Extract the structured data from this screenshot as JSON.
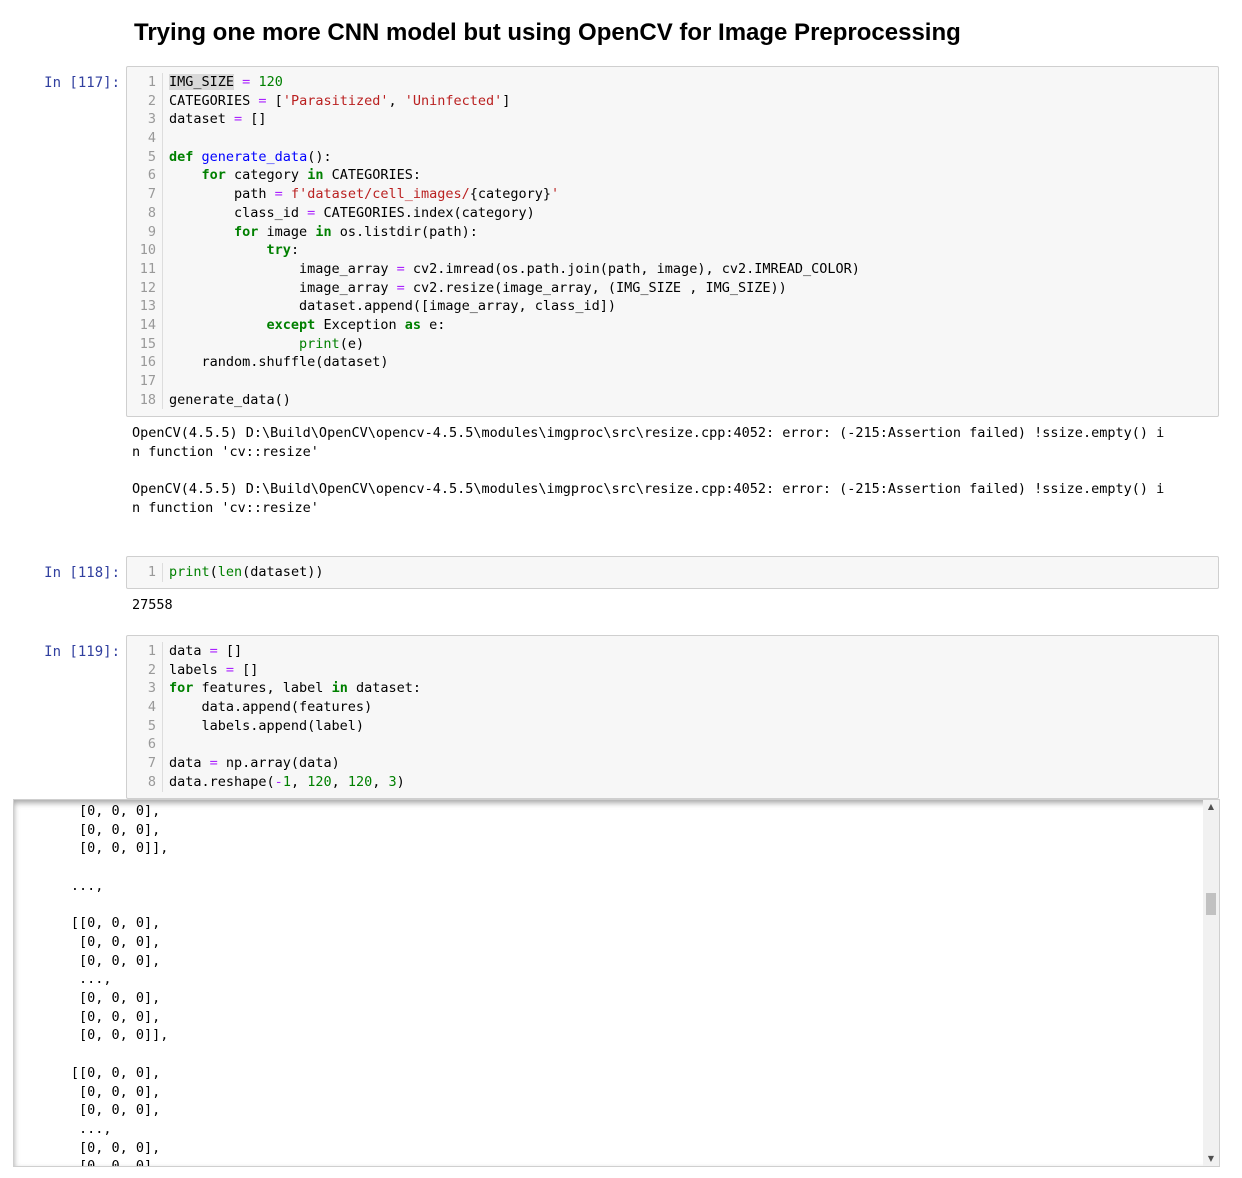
{
  "heading": "Trying one more CNN model but using OpenCV for Image Preprocessing",
  "cells": [
    {
      "prompt": "In [117]:",
      "line_numbers": [
        "1",
        "2",
        "3",
        "4",
        "5",
        "6",
        "7",
        "8",
        "9",
        "10",
        "11",
        "12",
        "13",
        "14",
        "15",
        "16",
        "17",
        "18"
      ],
      "output": "OpenCV(4.5.5) D:\\Build\\OpenCV\\opencv-4.5.5\\modules\\imgproc\\src\\resize.cpp:4052: error: (-215:Assertion failed) !ssize.empty() i\nn function 'cv::resize'\n\nOpenCV(4.5.5) D:\\Build\\OpenCV\\opencv-4.5.5\\modules\\imgproc\\src\\resize.cpp:4052: error: (-215:Assertion failed) !ssize.empty() i\nn function 'cv::resize'"
    },
    {
      "prompt": "In [118]:",
      "line_numbers": [
        "1"
      ],
      "output": "27558"
    },
    {
      "prompt": "In [119]:",
      "line_numbers": [
        "1",
        "2",
        "3",
        "4",
        "5",
        "6",
        "7",
        "8"
      ],
      "output": "        [0, 0, 0],\n        [0, 0, 0],\n        [0, 0, 0]],\n\n       ...,\n\n       [[0, 0, 0],\n        [0, 0, 0],\n        [0, 0, 0],\n        ...,\n        [0, 0, 0],\n        [0, 0, 0],\n        [0, 0, 0]],\n\n       [[0, 0, 0],\n        [0, 0, 0],\n        [0, 0, 0],\n        ...,\n        [0, 0, 0],\n        [0, 0, 0],"
    }
  ],
  "scrollbar": {
    "up_arrow": "▲",
    "down_arrow": "▼"
  },
  "colors": {
    "prompt": "#303f9f",
    "keyword": "#008000",
    "string": "#ba2121",
    "function": "#0000ff",
    "operator": "#aa22ff"
  }
}
